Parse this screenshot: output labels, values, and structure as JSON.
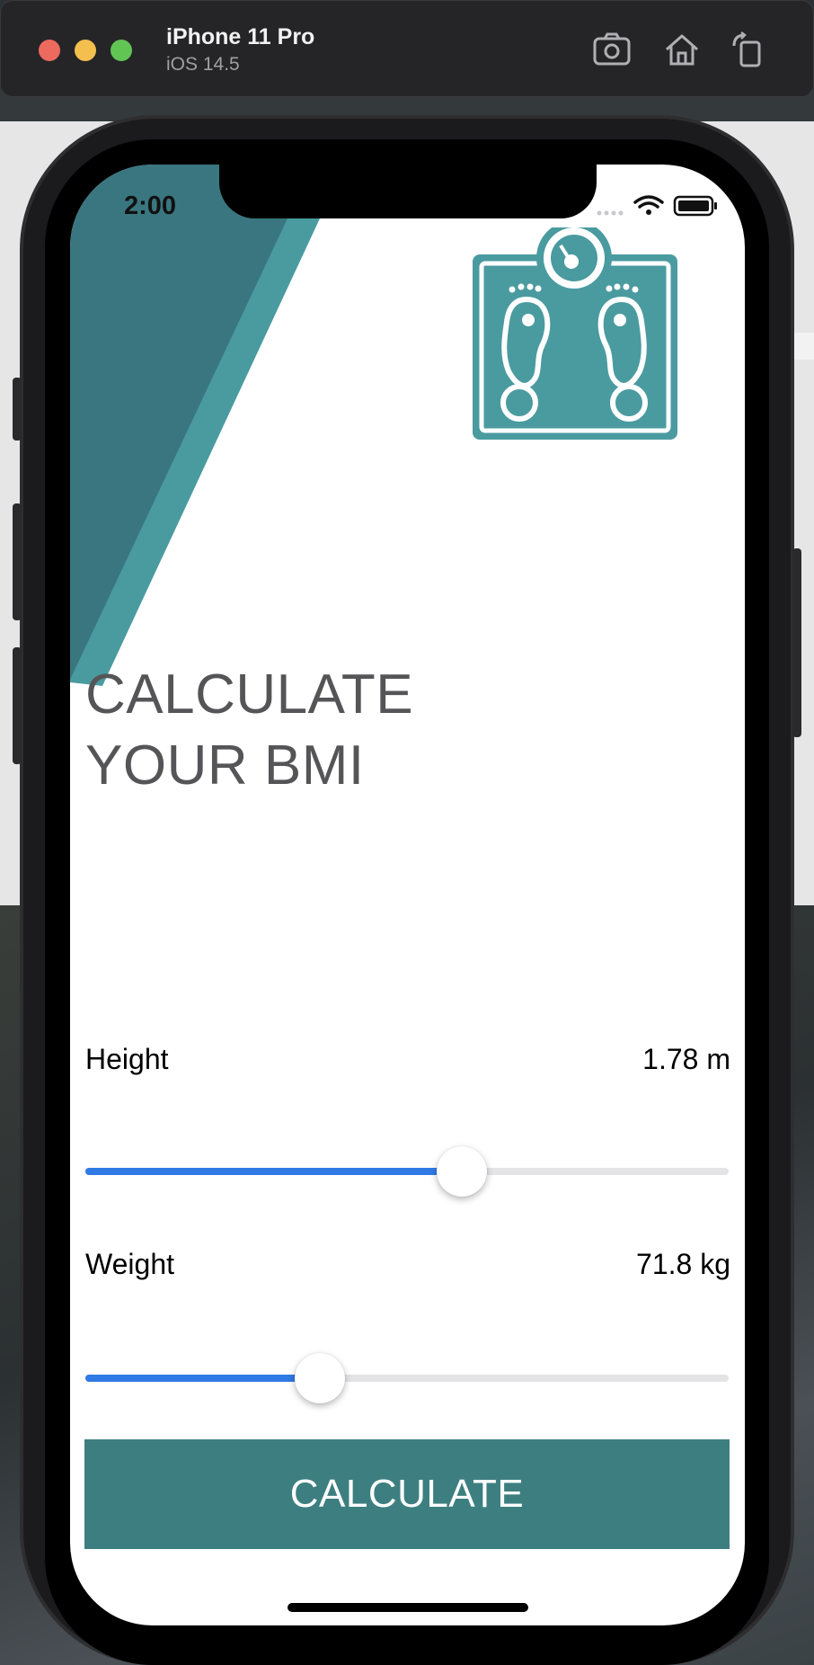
{
  "simulator": {
    "device_name": "iPhone 11 Pro",
    "os_version": "iOS 14.5",
    "toolbar_icons": [
      "screenshot-icon",
      "home-icon",
      "rotate-icon"
    ]
  },
  "status_bar": {
    "time": "2:00",
    "icons": [
      "cellular-icon",
      "wifi-icon",
      "battery-icon"
    ]
  },
  "app": {
    "logo_icon": "bathroom-scale-icon",
    "title_line1": "CALCULATE",
    "title_line2": "YOUR BMI",
    "height": {
      "label": "Height",
      "value": "1.78 m",
      "slider_fraction": 0.585
    },
    "weight": {
      "label": "Weight",
      "value": "71.8 kg",
      "slider_fraction": 0.365
    },
    "calculate_button": "CALCULATE"
  },
  "colors": {
    "teal_dark": "#3a767f",
    "teal_light": "#4a9ba0",
    "button": "#3d7f80",
    "slider_fill": "#2f7ae5",
    "title_text": "#555558"
  }
}
